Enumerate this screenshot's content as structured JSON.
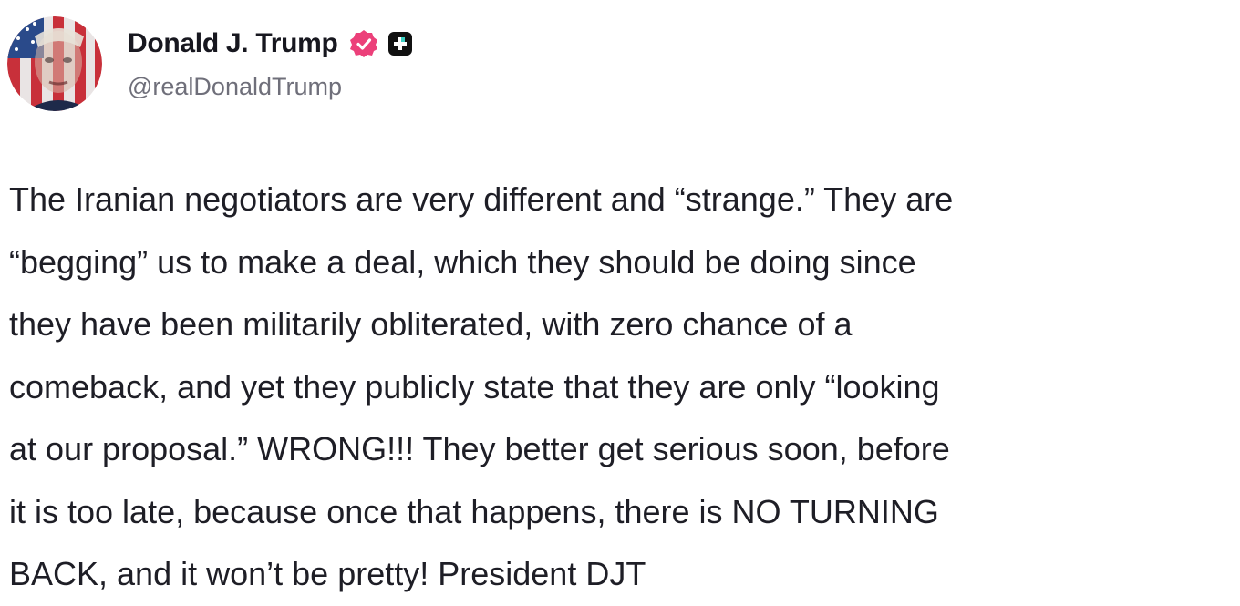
{
  "post": {
    "author": {
      "display_name": "Donald J. Trump",
      "handle": "@realDonaldTrump",
      "avatar_icon": "profile-avatar-flag-portrait",
      "verified_icon": "verified-badge-icon",
      "badge_icon": "app-badge-icon"
    },
    "text": "The Iranian negotiators are very different and “strange.” They are\n“begging” us to make a deal, which they should be doing since\nthey have been militarily obliterated, with zero chance of a\ncomeback, and yet they publicly state that they are only “looking\nat our proposal.” WRONG!!! They better get serious soon, before\nit is too late, because once that happens, there is NO TURNING\nBACK, and it won’t be pretty! President DJT"
  },
  "colors": {
    "text": "#1e1e26",
    "handle": "#6f6f7a",
    "verified": "#ec407a",
    "badge": "#111111",
    "flag_red": "#c8303a",
    "flag_blue": "#2a4a8a"
  }
}
